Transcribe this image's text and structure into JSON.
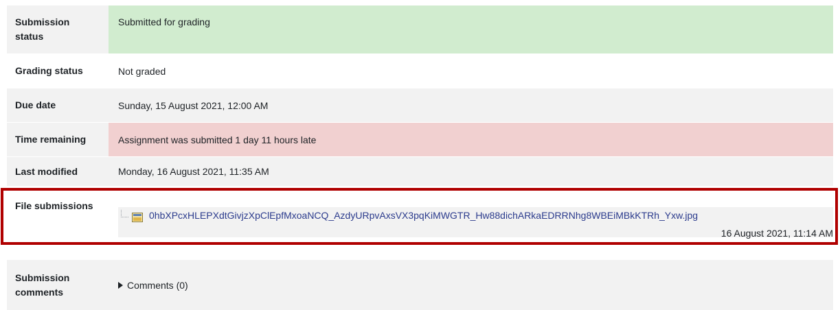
{
  "rows": {
    "submission_status": {
      "label": "Submission status",
      "value": "Submitted for grading"
    },
    "grading_status": {
      "label": "Grading status",
      "value": "Not graded"
    },
    "due_date": {
      "label": "Due date",
      "value": "Sunday, 15 August 2021, 12:00 AM"
    },
    "time_remaining": {
      "label": "Time remaining",
      "value": "Assignment was submitted 1 day 11 hours late"
    },
    "last_modified": {
      "label": "Last modified",
      "value": "Monday, 16 August 2021, 11:35 AM"
    },
    "file_submissions": {
      "label": "File submissions",
      "file_name": "0hbXPcxHLEPXdtGivjzXpClEpfMxoaNCQ_AzdyURpvAxsVX3pqKiMWGTR_Hw88dichARkaEDRRNhg8WBEiMBkKTRh_Yxw.jpg",
      "file_date": "16 August 2021, 11:14 AM",
      "file_icon": "image-file-icon"
    },
    "submission_comments": {
      "label": "Submission comments",
      "toggle_label": "Comments (0)"
    }
  },
  "colors": {
    "status_green": "#d1eccf",
    "late_red": "#f1d0d0",
    "highlight_border": "#b00000",
    "link": "#2a3a8c"
  }
}
